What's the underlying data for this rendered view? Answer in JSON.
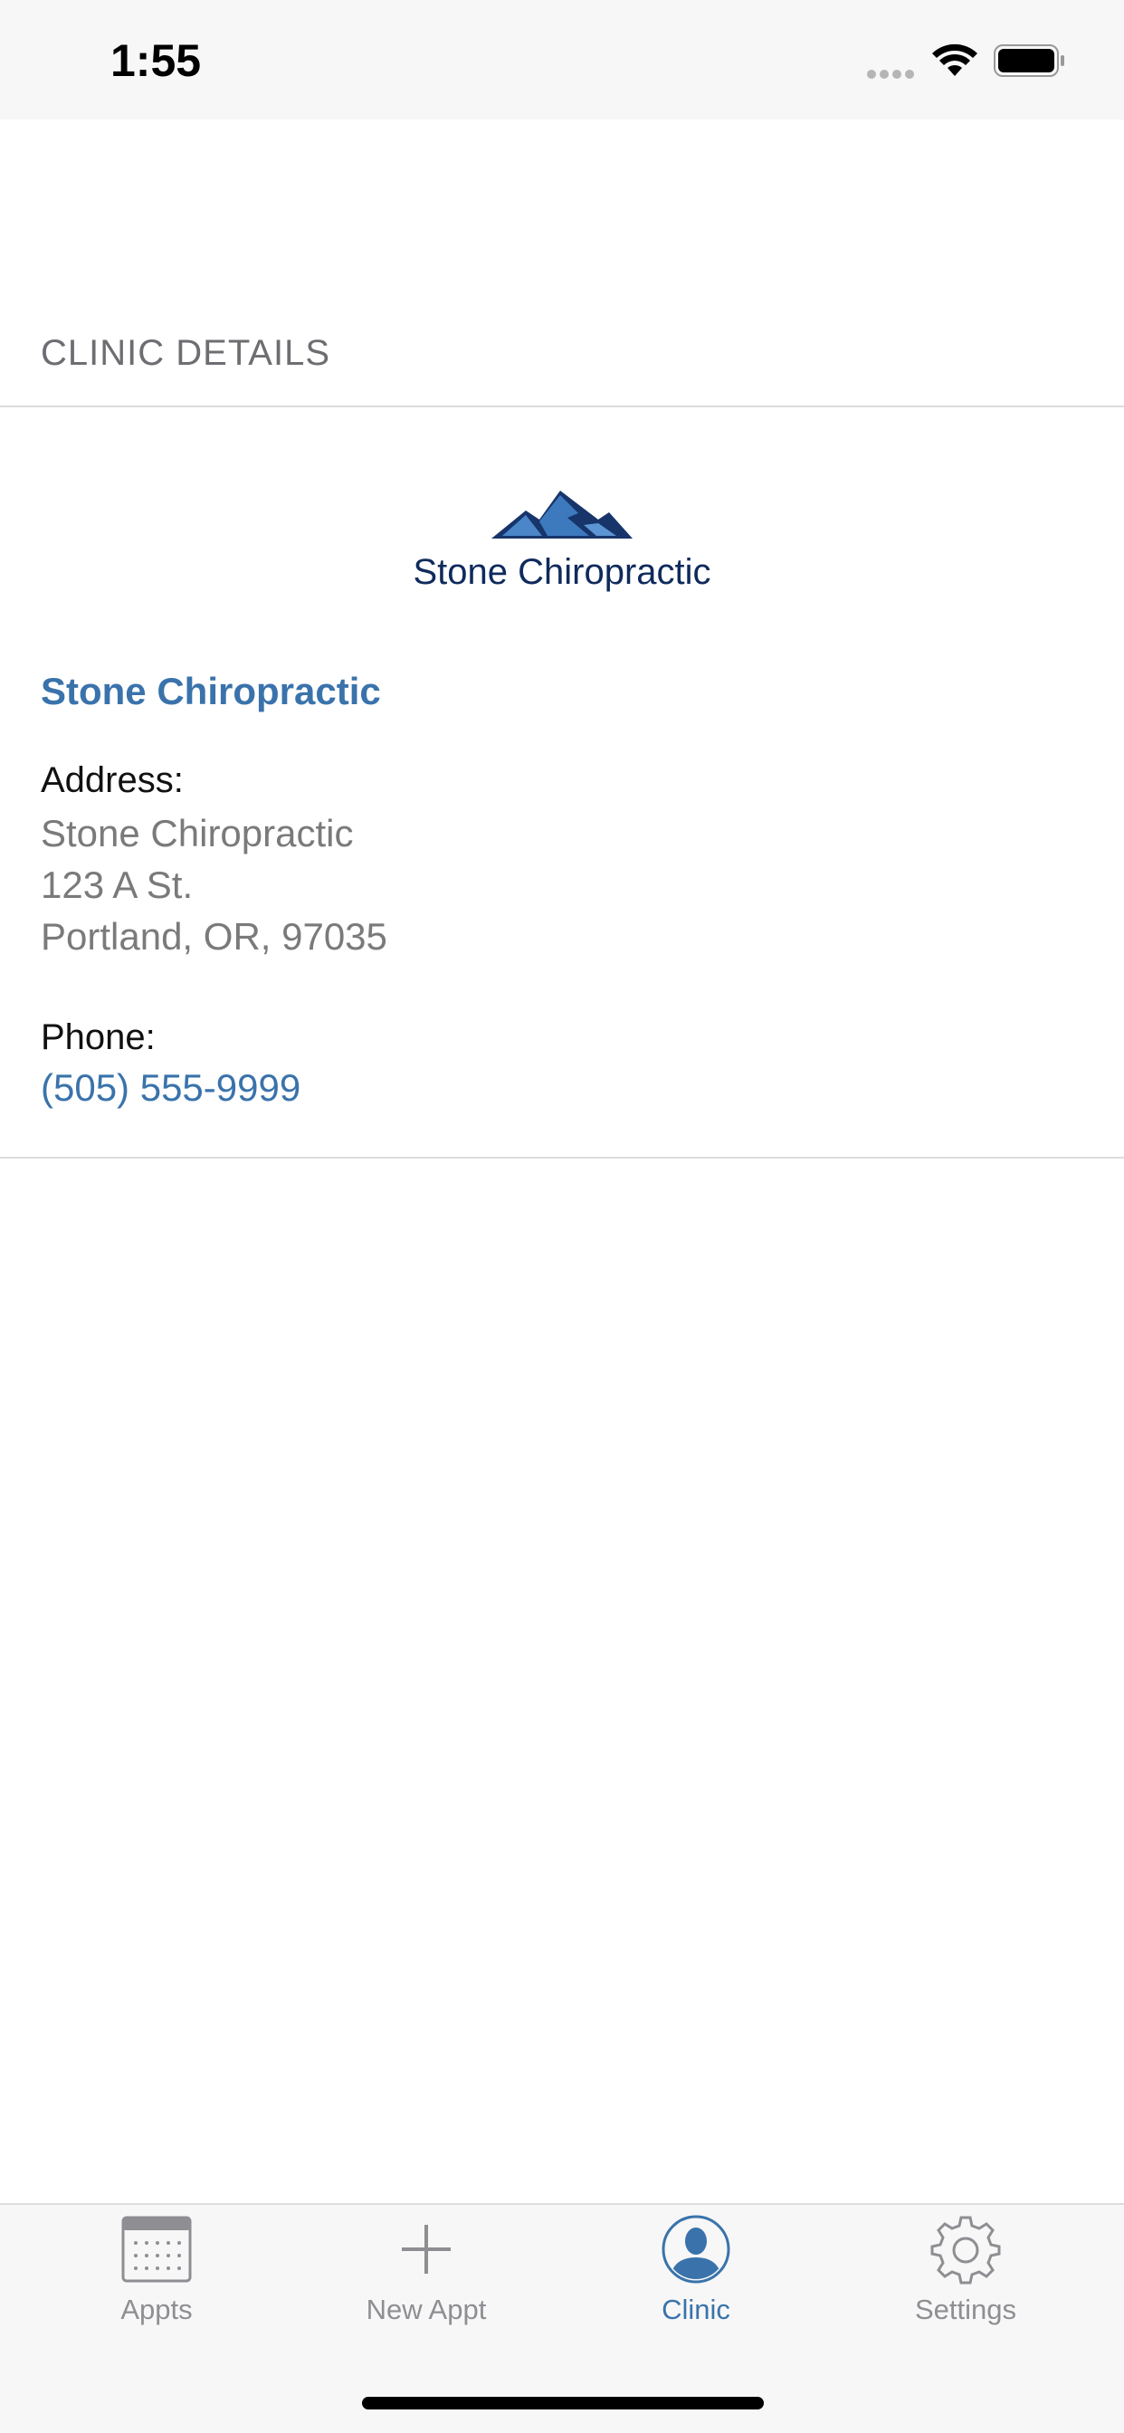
{
  "status_bar": {
    "time": "1:55"
  },
  "section": {
    "header": "CLINIC DETAILS"
  },
  "logo": {
    "text": "Stone Chiropractic"
  },
  "clinic": {
    "name": "Stone Chiropractic",
    "address_label": "Address:",
    "address_lines": [
      "Stone Chiropractic",
      "123 A St.",
      "Portland, OR, 97035"
    ],
    "phone_label": "Phone:",
    "phone": "(505) 555-9999"
  },
  "tabs": [
    {
      "label": "Appts",
      "icon": "calendar-icon"
    },
    {
      "label": "New Appt",
      "icon": "plus-icon"
    },
    {
      "label": "Clinic",
      "icon": "person-icon",
      "active": true
    },
    {
      "label": "Settings",
      "icon": "gear-icon"
    }
  ],
  "colors": {
    "accent": "#3a73ab",
    "logo_text": "#0f2a5c",
    "secondary_text": "#7a7a7a"
  }
}
